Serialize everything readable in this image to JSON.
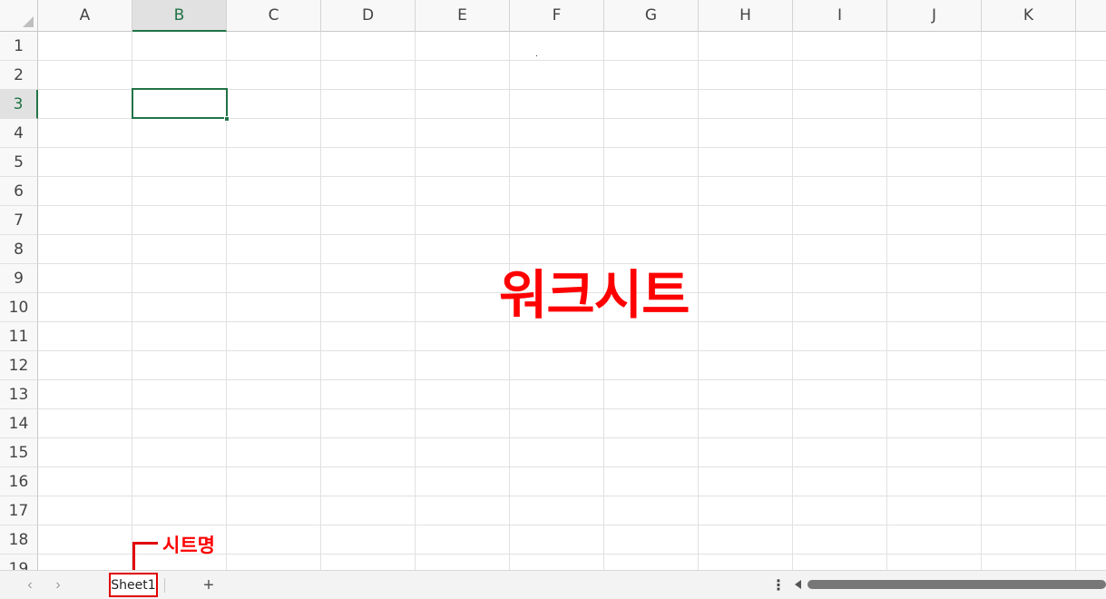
{
  "grid": {
    "columns": [
      "A",
      "B",
      "C",
      "D",
      "E",
      "F",
      "G",
      "H",
      "I",
      "J",
      "K"
    ],
    "rows": [
      "1",
      "2",
      "3",
      "4",
      "5",
      "6",
      "7",
      "8",
      "9",
      "10",
      "11",
      "12",
      "13",
      "14",
      "15",
      "16",
      "17",
      "18",
      "19"
    ],
    "active_column": "B",
    "active_row": "3"
  },
  "annotations": {
    "worksheet_label": "워크시트",
    "sheet_name_label": "시트명"
  },
  "tabs": {
    "sheet1": "Sheet1",
    "prev_icon": "‹",
    "next_icon": "›",
    "add_icon": "+",
    "more_icon": "⋮"
  },
  "colors": {
    "accent_green": "#217346",
    "annotation_red": "#ff0000"
  }
}
